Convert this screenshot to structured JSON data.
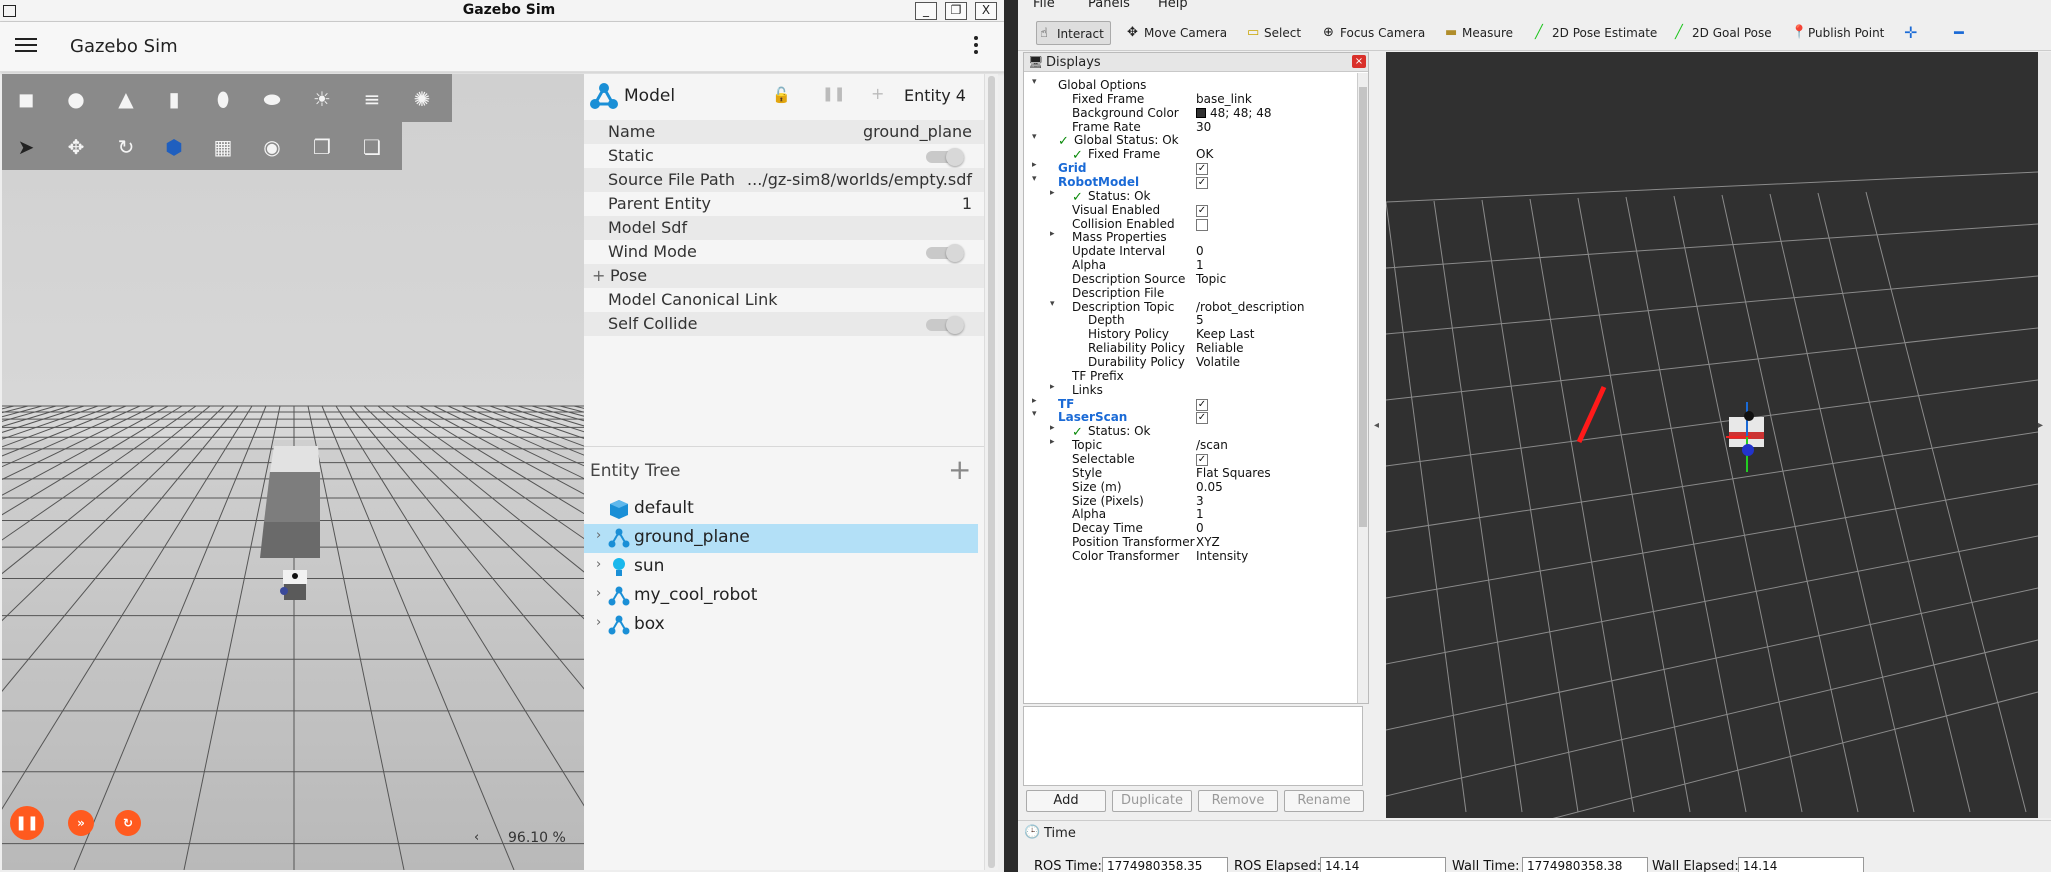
{
  "gazebo": {
    "window_title": "Gazebo Sim",
    "app_title": "Gazebo Sim",
    "window_buttons": [
      "_",
      "❐",
      "X"
    ],
    "toolbar_shapes": [
      "box-icon",
      "sphere-icon",
      "cone-icon",
      "cylinder-icon",
      "capsule-icon",
      "ellipsoid-icon",
      "directional-light-icon",
      "spot-light-icon",
      "point-light-icon"
    ],
    "toolbar_tools": [
      "select-icon",
      "translate-icon",
      "rotate-icon",
      "transform-icon",
      "grid-icon",
      "screenshot-icon",
      "copy-icon",
      "paste-icon"
    ],
    "real_time_factor": "96.10 %",
    "inspector": {
      "type_label": "Model",
      "entity_label": "Entity 4",
      "rows": [
        {
          "key": "Name",
          "value": "ground_plane"
        },
        {
          "key": "Static",
          "value": ""
        },
        {
          "key": "Source File Path",
          "value": ".../gz-sim8/worlds/empty.sdf"
        },
        {
          "key": "Parent Entity",
          "value": "1"
        },
        {
          "key": "Model Sdf",
          "value": ""
        },
        {
          "key": "Wind Mode",
          "value": ""
        },
        {
          "key": "Pose",
          "value": ""
        },
        {
          "key": "Model Canonical Link",
          "value": ""
        },
        {
          "key": "Self Collide",
          "value": ""
        }
      ],
      "pose_expander": "+"
    },
    "entity_tree": {
      "title": "Entity Tree",
      "add_symbol": "+",
      "items": [
        {
          "label": "default",
          "selected": false
        },
        {
          "label": "ground_plane",
          "selected": true
        },
        {
          "label": "sun",
          "selected": false
        },
        {
          "label": "my_cool_robot",
          "selected": false
        },
        {
          "label": "box",
          "selected": false
        }
      ]
    },
    "colors": {
      "control_orange": "#ff5a1f",
      "selected_row": "#b3e0f7"
    }
  },
  "rviz": {
    "menu": [
      "File",
      "Panels",
      "Help"
    ],
    "tools": [
      {
        "label": "Interact",
        "icon": "hand-icon",
        "active": true
      },
      {
        "label": "Move Camera",
        "icon": "move-camera-icon",
        "active": false
      },
      {
        "label": "Select",
        "icon": "select-icon",
        "active": false
      },
      {
        "label": "Focus Camera",
        "icon": "focus-camera-icon",
        "active": false
      },
      {
        "label": "Measure",
        "icon": "ruler-icon",
        "active": false
      },
      {
        "label": "2D Pose Estimate",
        "icon": "pose-estimate-icon",
        "active": false
      },
      {
        "label": "2D Goal Pose",
        "icon": "goal-pose-icon",
        "active": false
      },
      {
        "label": "Publish Point",
        "icon": "pin-icon",
        "active": false
      }
    ],
    "displays_title": "Displays",
    "displays": [
      {
        "level": 0,
        "exp": "▾",
        "name": "Global Options",
        "value": "",
        "style": "group"
      },
      {
        "level": 1,
        "name": "Fixed Frame",
        "value": "base_link"
      },
      {
        "level": 1,
        "name": "Background Color",
        "value": "48; 48; 48",
        "swatch": "#303030"
      },
      {
        "level": 1,
        "name": "Frame Rate",
        "value": "30"
      },
      {
        "level": 0,
        "exp": "▾",
        "check": true,
        "name": "Global Status: Ok",
        "value": ""
      },
      {
        "level": 1,
        "check": true,
        "name": "Fixed Frame",
        "value": "OK"
      },
      {
        "level": 0,
        "exp": "▸",
        "name": "Grid",
        "blue": true,
        "checkbox": true
      },
      {
        "level": 0,
        "exp": "▾",
        "name": "RobotModel",
        "blue": true,
        "checkbox": true
      },
      {
        "level": 1,
        "exp": "▸",
        "check": true,
        "name": "Status: Ok",
        "value": ""
      },
      {
        "level": 1,
        "name": "Visual Enabled",
        "checkbox": true
      },
      {
        "level": 1,
        "name": "Collision Enabled",
        "checkbox": false
      },
      {
        "level": 1,
        "exp": "▸",
        "name": "Mass Properties",
        "value": ""
      },
      {
        "level": 1,
        "name": "Update Interval",
        "value": "0"
      },
      {
        "level": 1,
        "name": "Alpha",
        "value": "1"
      },
      {
        "level": 1,
        "name": "Description Source",
        "value": "Topic"
      },
      {
        "level": 1,
        "name": "Description File",
        "value": ""
      },
      {
        "level": 1,
        "exp": "▾",
        "name": "Description Topic",
        "value": "/robot_description"
      },
      {
        "level": 2,
        "name": "Depth",
        "value": "5"
      },
      {
        "level": 2,
        "name": "History Policy",
        "value": "Keep Last"
      },
      {
        "level": 2,
        "name": "Reliability Policy",
        "value": "Reliable"
      },
      {
        "level": 2,
        "name": "Durability Policy",
        "value": "Volatile"
      },
      {
        "level": 1,
        "name": "TF Prefix",
        "value": ""
      },
      {
        "level": 1,
        "exp": "▸",
        "name": "Links",
        "value": ""
      },
      {
        "level": 0,
        "exp": "▸",
        "name": "TF",
        "blue": true,
        "checkbox": true
      },
      {
        "level": 0,
        "exp": "▾",
        "name": "LaserScan",
        "blue": true,
        "checkbox": true
      },
      {
        "level": 1,
        "exp": "▸",
        "check": true,
        "name": "Status: Ok",
        "value": ""
      },
      {
        "level": 1,
        "exp": "▸",
        "name": "Topic",
        "value": "/scan"
      },
      {
        "level": 1,
        "name": "Selectable",
        "checkbox": true
      },
      {
        "level": 1,
        "name": "Style",
        "value": "Flat Squares"
      },
      {
        "level": 1,
        "name": "Size (m)",
        "value": "0.05"
      },
      {
        "level": 1,
        "name": "Size (Pixels)",
        "value": "3"
      },
      {
        "level": 1,
        "name": "Alpha",
        "value": "1"
      },
      {
        "level": 1,
        "name": "Decay Time",
        "value": "0"
      },
      {
        "level": 1,
        "name": "Position Transformer",
        "value": "XYZ"
      },
      {
        "level": 1,
        "name": "Color Transformer",
        "value": "Intensity"
      }
    ],
    "panel_buttons": [
      {
        "label": "Add",
        "enabled": true
      },
      {
        "label": "Duplicate",
        "enabled": false
      },
      {
        "label": "Remove",
        "enabled": false
      },
      {
        "label": "Rename",
        "enabled": false
      }
    ],
    "time": {
      "title": "Time",
      "ros_time_label": "ROS Time:",
      "ros_time": "1774980358.35",
      "ros_elapsed_label": "ROS Elapsed:",
      "ros_elapsed": "14.14",
      "wall_time_label": "Wall Time:",
      "wall_time": "1774980358.38",
      "wall_elapsed_label": "Wall Elapsed:",
      "wall_elapsed": "14.14"
    },
    "colors": {
      "viewport_bg": "#303030",
      "laser_red": "#ff1a1a"
    }
  }
}
